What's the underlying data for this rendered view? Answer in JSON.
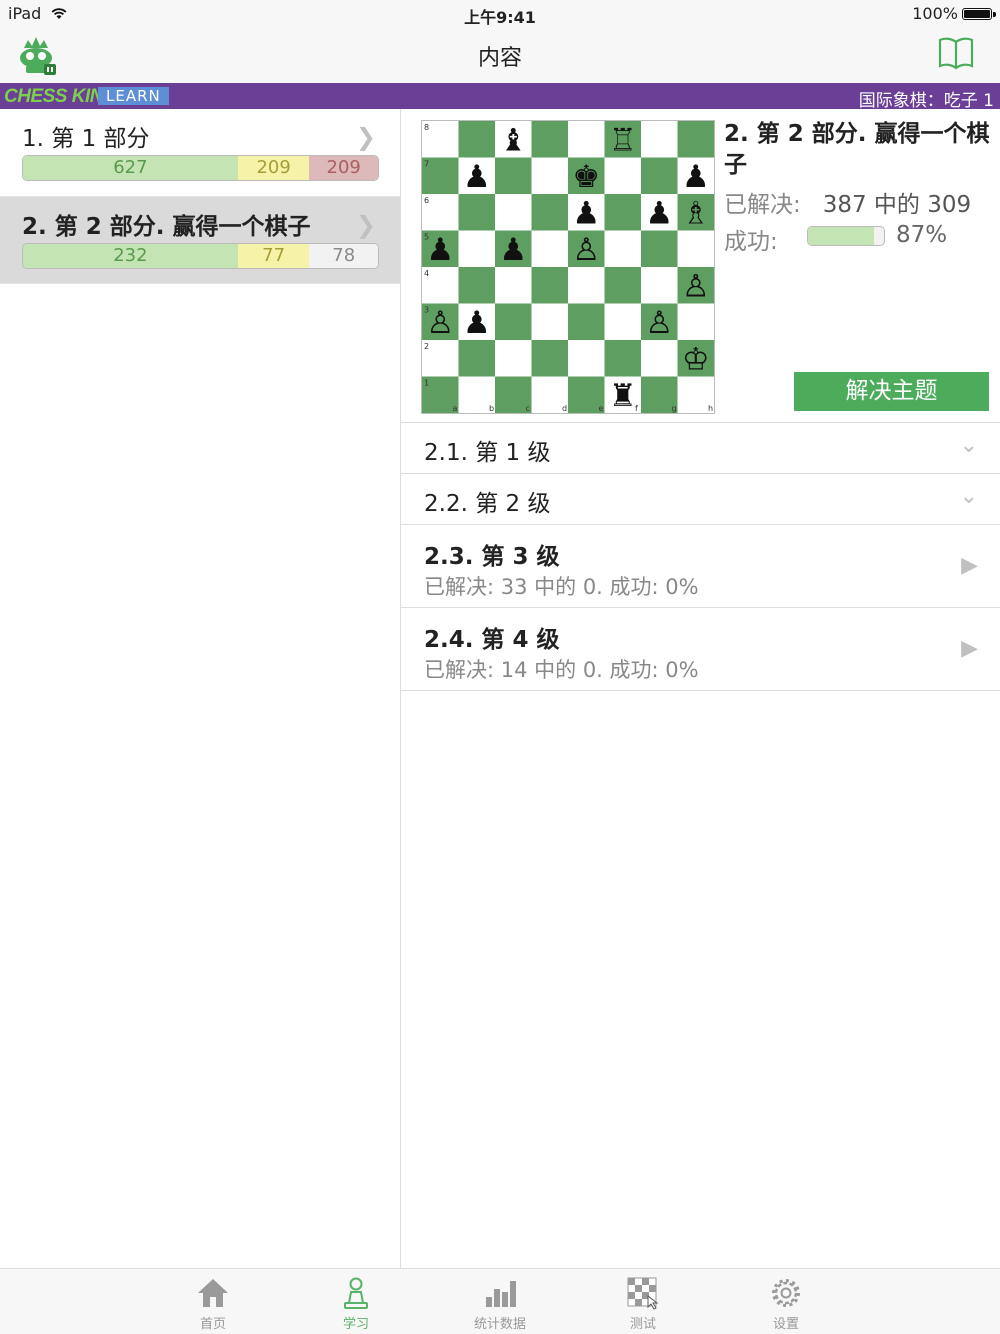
{
  "status": {
    "device": "iPad",
    "time": "上午9:41",
    "battery": "100%"
  },
  "nav": {
    "title": "内容",
    "logo_icon": "chess-king-logo-icon",
    "book_icon": "book-icon"
  },
  "banner": {
    "brand": "CHESS KING",
    "learn": "LEARN",
    "breadcrumb": "国际象棋：吃子 1"
  },
  "parts": [
    {
      "title": "1. 第 1 部分",
      "solved": "627",
      "partial": "209",
      "third": "209",
      "third_type": "failed",
      "selected": false
    },
    {
      "title": "2. 第 2 部分. 赢得一个棋子",
      "solved": "232",
      "partial": "77",
      "third": "78",
      "third_type": "unsolved",
      "selected": true
    }
  ],
  "detail": {
    "title": "2. 第 2 部分. 赢得一个棋子",
    "solved_label": "已解决:",
    "solved_value": "387 中的 309",
    "success_label": "成功:",
    "success_pct": "87%",
    "success_fraction": 0.87,
    "solve_button": "解决主题"
  },
  "board": {
    "files": [
      "a",
      "b",
      "c",
      "d",
      "e",
      "f",
      "g",
      "h"
    ],
    "ranks": [
      "8",
      "7",
      "6",
      "5",
      "4",
      "3",
      "2",
      "1"
    ],
    "pieces": [
      {
        "sq": "c8",
        "glyph": "♝"
      },
      {
        "sq": "f8",
        "glyph": "♖"
      },
      {
        "sq": "b7",
        "glyph": "♟"
      },
      {
        "sq": "e7",
        "glyph": "♚"
      },
      {
        "sq": "h7",
        "glyph": "♟"
      },
      {
        "sq": "e6",
        "glyph": "♟"
      },
      {
        "sq": "g6",
        "glyph": "♟"
      },
      {
        "sq": "h6",
        "glyph": "♗"
      },
      {
        "sq": "a5",
        "glyph": "♟"
      },
      {
        "sq": "c5",
        "glyph": "♟"
      },
      {
        "sq": "e5",
        "glyph": "♙"
      },
      {
        "sq": "h4",
        "glyph": "♙"
      },
      {
        "sq": "a3",
        "glyph": "♙"
      },
      {
        "sq": "b3",
        "glyph": "♟"
      },
      {
        "sq": "g3",
        "glyph": "♙"
      },
      {
        "sq": "h2",
        "glyph": "♔"
      },
      {
        "sq": "f1",
        "glyph": "♜"
      }
    ],
    "light_color": "#ffffff",
    "dark_color": "#5f9e61"
  },
  "levels": [
    {
      "title": "2.1. 第 1 级",
      "subtitle": "",
      "icon": "chevron-down-icon",
      "expanded": false
    },
    {
      "title": "2.2. 第 2 级",
      "subtitle": "",
      "icon": "chevron-down-icon",
      "expanded": false
    },
    {
      "title": "2.3. 第 3 级",
      "subtitle": "已解决:   33 中的 0. 成功:   0%",
      "icon": "play-icon",
      "expanded": true
    },
    {
      "title": "2.4. 第 4 级",
      "subtitle": "已解决:   14 中的 0. 成功:   0%",
      "icon": "play-icon",
      "expanded": true
    }
  ],
  "tabs": [
    {
      "label": "首页",
      "icon": "home-icon",
      "active": false
    },
    {
      "label": "学习",
      "icon": "pawn-icon",
      "active": true
    },
    {
      "label": "统计数据",
      "icon": "bar-chart-icon",
      "active": false
    },
    {
      "label": "测试",
      "icon": "board-test-icon",
      "active": false
    },
    {
      "label": "设置",
      "icon": "gear-icon",
      "active": false
    }
  ],
  "colors": {
    "accent_green": "#4cac5b",
    "banner_purple": "#6b3f96",
    "tab_active": "#57b368"
  }
}
